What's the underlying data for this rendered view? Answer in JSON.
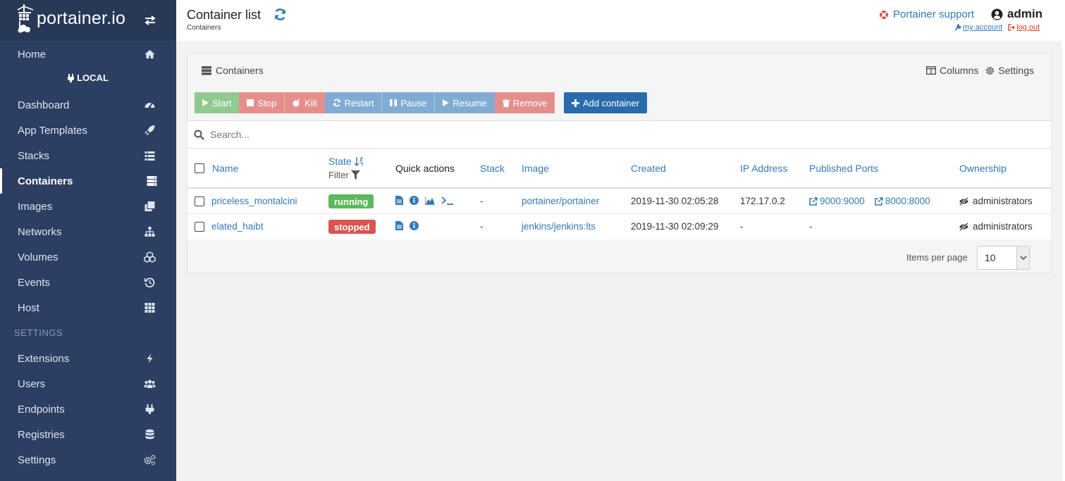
{
  "brand": {
    "name": "portainer.io"
  },
  "sidebar": {
    "environment": "LOCAL",
    "settings_title": "SETTINGS",
    "items": [
      {
        "label": "Home",
        "icon": "home-icon"
      },
      {
        "label": "Dashboard",
        "icon": "dashboard-icon"
      },
      {
        "label": "App Templates",
        "icon": "rocket-icon"
      },
      {
        "label": "Stacks",
        "icon": "list-icon"
      },
      {
        "label": "Containers",
        "icon": "server-icon"
      },
      {
        "label": "Images",
        "icon": "clone-icon"
      },
      {
        "label": "Networks",
        "icon": "sitemap-icon"
      },
      {
        "label": "Volumes",
        "icon": "cubes-icon"
      },
      {
        "label": "Events",
        "icon": "history-icon"
      },
      {
        "label": "Host",
        "icon": "grid-icon"
      },
      {
        "label": "Extensions",
        "icon": "bolt-icon"
      },
      {
        "label": "Users",
        "icon": "users-icon"
      },
      {
        "label": "Endpoints",
        "icon": "plug-icon"
      },
      {
        "label": "Registries",
        "icon": "database-icon"
      },
      {
        "label": "Settings",
        "icon": "cogs-icon"
      }
    ]
  },
  "header": {
    "title": "Container list",
    "breadcrumb": "Containers",
    "support": "Portainer support",
    "user": "admin",
    "my_account": "my account",
    "log_out": "log out"
  },
  "panel": {
    "title": "Containers",
    "columns_label": "Columns",
    "settings_label": "Settings",
    "actions": {
      "start": "Start",
      "stop": "Stop",
      "kill": "Kill",
      "restart": "Restart",
      "pause": "Pause",
      "resume": "Resume",
      "remove": "Remove",
      "add": "Add container"
    },
    "search_placeholder": "Search...",
    "columns": {
      "name": "Name",
      "state": "State",
      "filter": "Filter",
      "quick_actions": "Quick actions",
      "stack": "Stack",
      "image": "Image",
      "created": "Created",
      "ip": "IP Address",
      "ports": "Published Ports",
      "ownership": "Ownership"
    },
    "rows": [
      {
        "name": "priceless_montalcini",
        "state": "running",
        "stack": "-",
        "image": "portainer/portainer",
        "created": "2019-11-30 02:05:28",
        "ip": "172.17.0.2",
        "ports": [
          "9000:9000",
          "8000:8000"
        ],
        "ownership": "administrators"
      },
      {
        "name": "elated_haibt",
        "state": "stopped",
        "stack": "-",
        "image": "jenkins/jenkins:lts",
        "created": "2019-11-30 02:09:29",
        "ip": "-",
        "ports_text": "-",
        "ownership": "administrators"
      }
    ],
    "items_per_page_label": "Items per page",
    "items_per_page": "10"
  },
  "colors": {
    "sidebar": "#2d3e63",
    "link": "#337ab7",
    "running": "#5cb85c",
    "stopped": "#d9534f",
    "primary": "#2a6bae"
  }
}
